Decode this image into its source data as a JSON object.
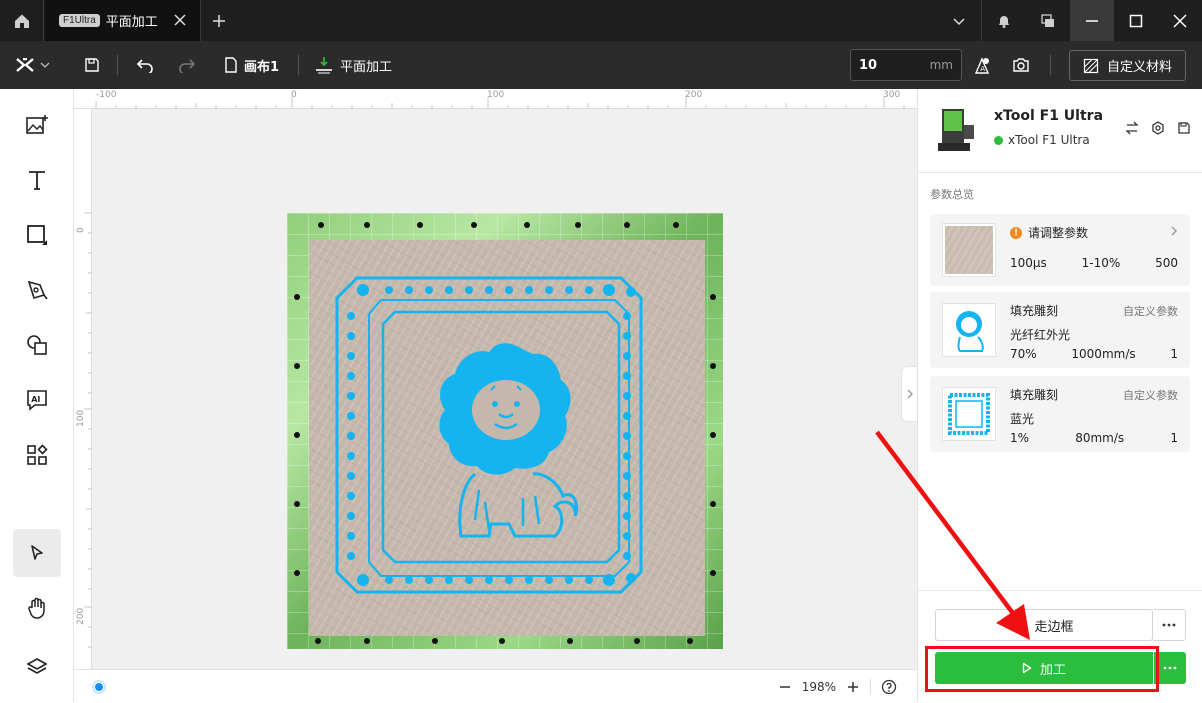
{
  "titlebar": {
    "tab_badge": "F1Ultra",
    "tab_label": "平面加工"
  },
  "toolbar": {
    "canvas_name": "画布1",
    "process_mode": "平面加工",
    "thickness_value": "10",
    "thickness_unit": "mm",
    "material_label": "自定义材料"
  },
  "canvas": {
    "ruler_top": [
      "-100",
      "0",
      "100",
      "200",
      "300"
    ],
    "ruler_left": [
      "0",
      "100",
      "200"
    ],
    "zoom": "198%"
  },
  "device": {
    "name": "xTool F1 Ultra",
    "connection": "xTool F1 Ultra",
    "status_color": "#2bbd3c"
  },
  "params": {
    "section_title": "参数总览",
    "cards": [
      {
        "title": "请调整参数",
        "right": "",
        "sub": "",
        "values": [
          "100μs",
          "1-10%",
          "500"
        ]
      },
      {
        "title": "填充雕刻",
        "right": "自定义参数",
        "sub": "光纤红外光",
        "values": [
          "70%",
          "1000mm/s",
          "1"
        ]
      },
      {
        "title": "填充雕刻",
        "right": "自定义参数",
        "sub": "蓝光",
        "values": [
          "1%",
          "80mm/s",
          "1"
        ]
      }
    ]
  },
  "actions": {
    "frame_label": "走边框",
    "start_label": "加工"
  },
  "colors": {
    "accent_green": "#2bbd3c",
    "design_blue": "#14b4f0",
    "annotation_red": "#ee1111"
  }
}
